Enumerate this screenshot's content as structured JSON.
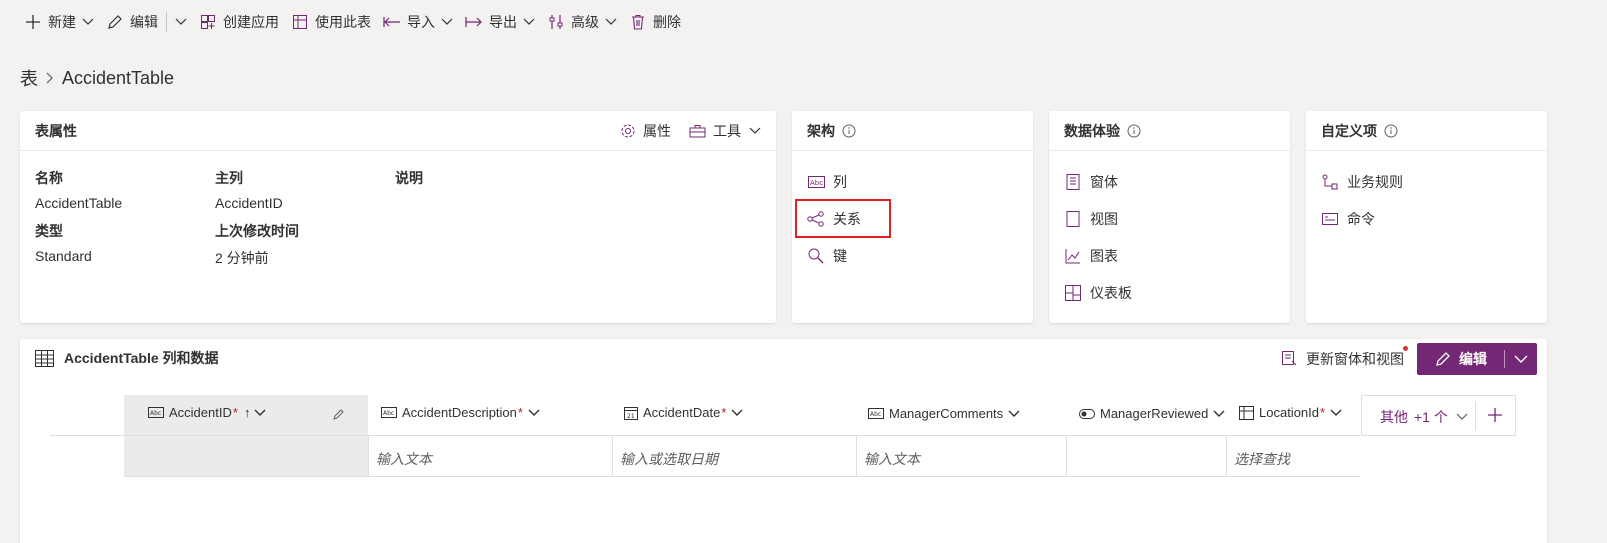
{
  "colors": {
    "accent": "#742774",
    "highlight": "#e02020",
    "required": "#a4262c"
  },
  "toolbar": {
    "new": "新建",
    "edit": "编辑",
    "create_app": "创建应用",
    "use_table": "使用此表",
    "import": "导入",
    "export": "导出",
    "advanced": "高级",
    "delete": "删除"
  },
  "breadcrumb": {
    "root": "表",
    "current": "AccidentTable"
  },
  "props_card": {
    "title": "表属性",
    "properties_btn": "属性",
    "tools_btn": "工具",
    "name_label": "名称",
    "name_value": "AccidentTable",
    "type_label": "类型",
    "type_value": "Standard",
    "primary_label": "主列",
    "primary_value": "AccidentID",
    "modified_label": "上次修改时间",
    "modified_value": "2 分钟前",
    "desc_label": "说明"
  },
  "schema_card": {
    "title": "架构",
    "columns": "列",
    "relationships": "关系",
    "keys": "键"
  },
  "data_exp_card": {
    "title": "数据体验",
    "forms": "窗体",
    "views": "视图",
    "charts": "图表",
    "dashboards": "仪表板"
  },
  "custom_card": {
    "title": "自定义项",
    "business_rules": "业务规则",
    "commands": "命令"
  },
  "data_panel": {
    "title": "AccidentTable 列和数据",
    "update_forms": "更新窗体和视图",
    "edit_btn": "编辑",
    "more_cols": "其他",
    "more_count": "+1 个",
    "columns": [
      {
        "name": "AccidentID",
        "required": "*",
        "sort": "↑",
        "placeholder": ""
      },
      {
        "name": "AccidentDescription",
        "required": "*",
        "placeholder": "输入文本"
      },
      {
        "name": "AccidentDate",
        "required": "*",
        "placeholder": "输入或选取日期"
      },
      {
        "name": "ManagerComments",
        "required": "",
        "placeholder": "输入文本"
      },
      {
        "name": "ManagerReviewed",
        "required": "",
        "placeholder": ""
      },
      {
        "name": "LocationId",
        "required": "*",
        "placeholder": "选择查找"
      }
    ]
  }
}
